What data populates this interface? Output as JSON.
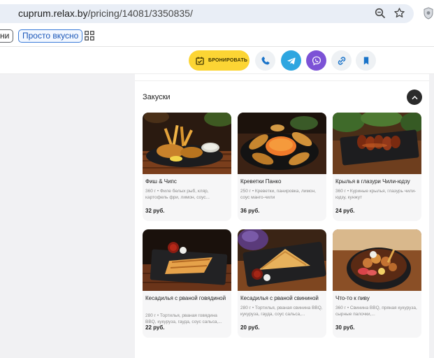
{
  "browser": {
    "url_host": "cuprum.relax.by",
    "url_path": "/pricing/14081/3350835/",
    "bookmarks": [
      "ни",
      "Просто вкусно"
    ]
  },
  "header": {
    "book_label": "БРОНИРОВАТЬ",
    "accent_color": "#fcd534"
  },
  "section": {
    "title": "Закуски"
  },
  "items": [
    {
      "name": "Фиш & Чипс",
      "desc": "360 г • Филе белых рыб, кляр, картофель фри, лимон, соус...",
      "price": "32 руб."
    },
    {
      "name": "Креветки Панко",
      "desc": "250 г • Креветки, панировка, лимон, соус манго-чили",
      "price": "36 руб."
    },
    {
      "name": "Крылья в глазури Чили-юдзу",
      "desc": "360 г • Куриные крылья, глазурь чили-юдзу, кунжут",
      "price": "24 руб."
    },
    {
      "name": "Кесадилья с рваной говядиной",
      "desc": "280 г • Тортилья, рваная говядина BBQ, кукуруза, гауда, соус сальса,...",
      "price": "22 руб."
    },
    {
      "name": "Кесадилья с рваной свининой",
      "desc": "280 г • Тортилья, рваная свинина BBQ, кукуруза, гауда, соус сальса,...",
      "price": "20 руб."
    },
    {
      "name": "Что-то к пиву",
      "desc": "360 г • Свинина BBQ, пряная кукуруза, сырные палочки,...",
      "price": "30 руб."
    }
  ]
}
